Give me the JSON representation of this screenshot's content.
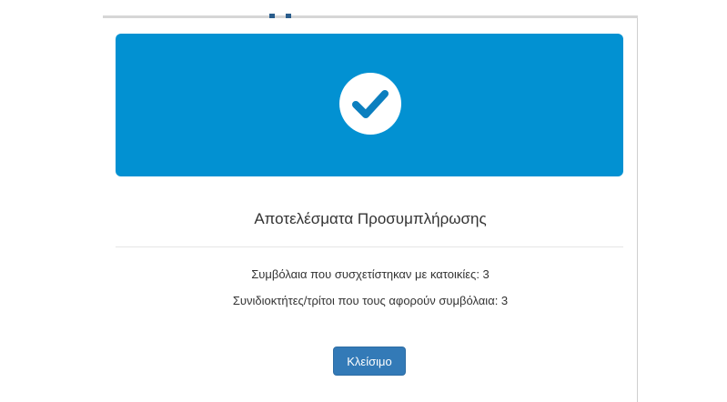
{
  "dialog": {
    "icon": "check-circle-icon",
    "accent_color": "#0291d2",
    "title": "Αποτελέσματα Προσυμπλήρωσης",
    "results": [
      "Συμβόλαια που συσχετίστηκαν με κατοικίες: 3",
      "Συνιδιοκτήτες/τρίτοι που τους αφορούν συμβόλαια: 3"
    ],
    "close_button_label": "Κλείσιμο",
    "close_button_color": "#337ab7"
  }
}
